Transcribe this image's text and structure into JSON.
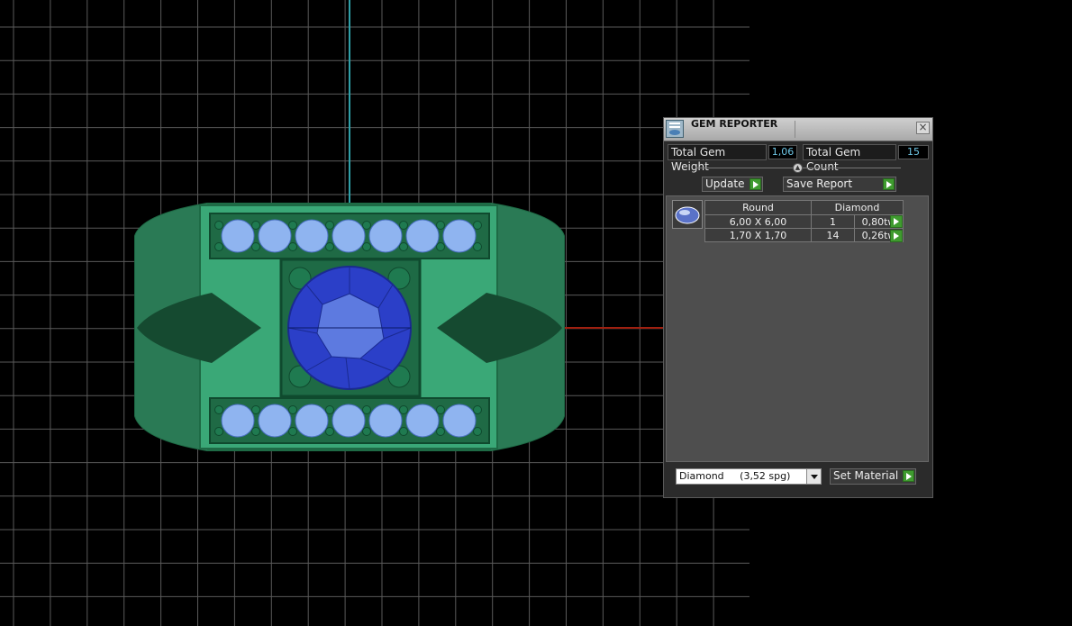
{
  "panel": {
    "title": "GEM REPORTER",
    "close_glyph": "×",
    "total_weight_label": "Total Gem Weight",
    "total_weight_value": "1,06",
    "total_count_label": "Total Gem Count",
    "total_count_value": "15",
    "update_label": "Update",
    "save_report_label": "Save Report",
    "table": {
      "headers": [
        "Round",
        "Diamond"
      ],
      "rows": [
        {
          "size": "6,00 X 6,00",
          "count": "1",
          "weight": "0,80tw"
        },
        {
          "size": "1,70 X 1,70",
          "count": "14",
          "weight": "0,26tw"
        }
      ]
    },
    "material_select": "Diamond     (3,52 spg)",
    "set_material_label": "Set Material"
  },
  "icons": {
    "title_icon": "gem-reporter-icon",
    "close": "close-icon",
    "collapse": "collapse-arrow-icon",
    "gem_thumb": "gem-oval-thumbnail-icon",
    "play": "green-arrow-icon"
  },
  "colors": {
    "background": "#000000",
    "grid": "#5a5a5a",
    "axis_vertical": "#2fa0a8",
    "axis_horizontal": "#a02010",
    "ring_metal": "#2f9a6a",
    "small_gems": "#8fb4f0",
    "center_gem": "#2b3fc8",
    "accent_green": "#3f9b2f",
    "value_text": "#6fc7e6"
  }
}
